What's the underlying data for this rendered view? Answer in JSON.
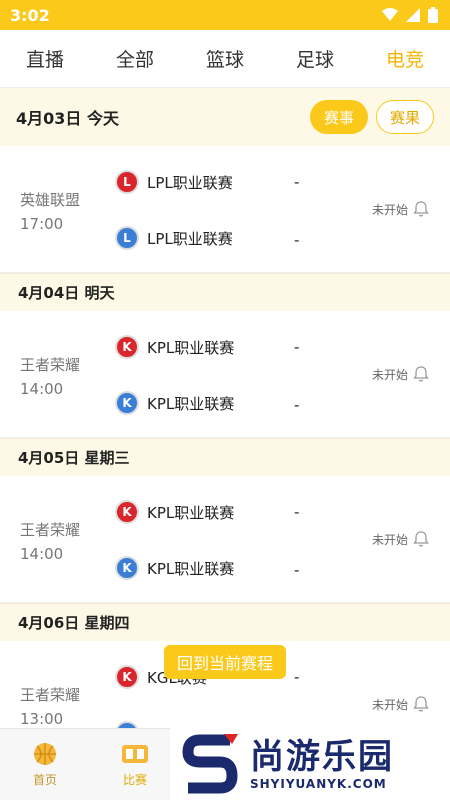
{
  "status_bar": {
    "time": "3:02"
  },
  "tabs": [
    {
      "label": "直播"
    },
    {
      "label": "全部"
    },
    {
      "label": "篮球"
    },
    {
      "label": "足球"
    },
    {
      "label": "电竞"
    }
  ],
  "active_tab": "电竞",
  "today_header": {
    "date": "4月03日  今天",
    "btn_matches": "赛事",
    "btn_results": "赛果"
  },
  "groups": [
    {
      "match": {
        "game": "英雄联盟",
        "time": "17:00",
        "team1": "LPL职业联赛",
        "team1_logo": "L",
        "team2": "LPL职业联赛",
        "team2_logo": "L",
        "score1": "-",
        "score2": "-",
        "status": "未开始"
      }
    },
    {
      "date": "4月04日   明天",
      "match": {
        "game": "王者荣耀",
        "time": "14:00",
        "team1": "KPL职业联赛",
        "team1_logo": "K",
        "team2": "KPL职业联赛",
        "team2_logo": "K",
        "score1": "-",
        "score2": "-",
        "status": "未开始"
      }
    },
    {
      "date": "4月05日   星期三",
      "match": {
        "game": "王者荣耀",
        "time": "14:00",
        "team1": "KPL职业联赛",
        "team1_logo": "K",
        "team2": "KPL职业联赛",
        "team2_logo": "K",
        "score1": "-",
        "score2": "-",
        "status": "未开始"
      }
    },
    {
      "date": "4月06日   星期四",
      "match": {
        "game": "王者荣耀",
        "time": "13:00",
        "team1": "KGL联赛",
        "team1_logo": "K",
        "team2": "",
        "team2_logo": "",
        "score1": "-",
        "score2": "",
        "status": "未开始"
      }
    }
  ],
  "float_button": "回到当前赛程",
  "bottom_nav": [
    {
      "label": "首页",
      "icon": "basketball-icon"
    },
    {
      "label": "比赛",
      "icon": "scoreboard-icon"
    }
  ],
  "watermark": {
    "brand": "尚游乐园",
    "url": "SHYIYUANYK.COM"
  },
  "colors": {
    "accent": "#fbc919",
    "highlight": "#f5b400",
    "date_bg": "#fef9e6"
  }
}
